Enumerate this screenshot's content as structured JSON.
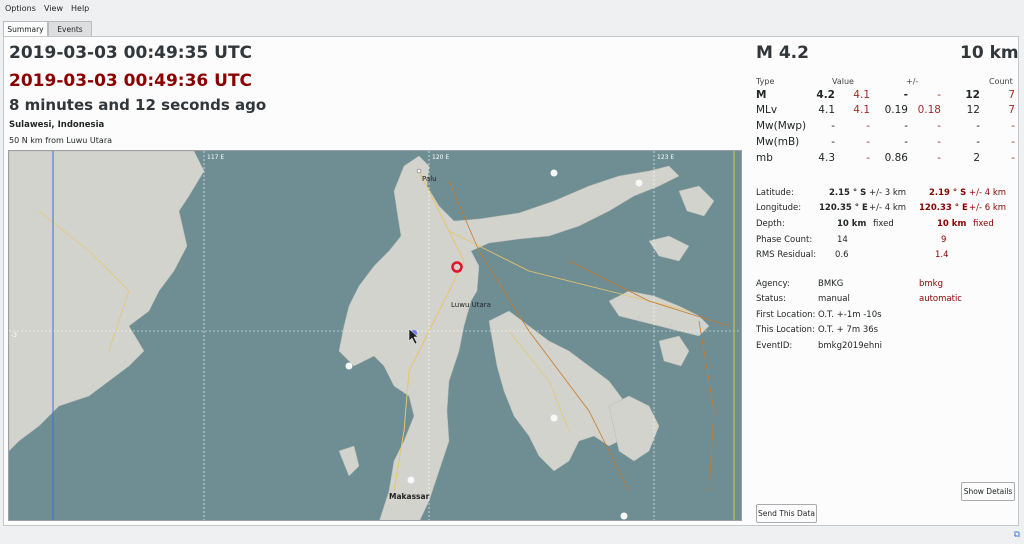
{
  "menu": {
    "items": [
      "Options",
      "View",
      "Help"
    ]
  },
  "tabs": [
    {
      "label": "Summary"
    },
    {
      "label": "Events"
    }
  ],
  "summary": {
    "time1": "2019-03-03 00:49:35 UTC",
    "time2": "2019-03-03 00:49:36 UTC",
    "ago": "8 minutes and 12 seconds ago",
    "region": "Sulawesi, Indonesia",
    "distance": "50 N km from Luwu Utara"
  },
  "map": {
    "grid_labels": [
      "117 E",
      "120 E",
      "123 E",
      "-3"
    ],
    "places": [
      "Palu",
      "Luwu Utara",
      "Makassar"
    ],
    "colors": {
      "water": "#6e8e94",
      "land": "#d2d3cd",
      "event": "#e0142b"
    }
  },
  "event": {
    "magnitude": "M 4.2",
    "depth": "10 km"
  },
  "magnitudes": {
    "headers": {
      "type": "Type",
      "value": "Value",
      "pm": "+/-",
      "count": "Count"
    },
    "rows": [
      {
        "type": "M",
        "v1": "4.2",
        "v2": "4.1",
        "e1": "-",
        "e2": "-",
        "c1": "12",
        "c2": "7",
        "bold": true
      },
      {
        "type": "MLv",
        "v1": "4.1",
        "v2": "4.1",
        "e1": "0.19",
        "e2": "0.18",
        "c1": "12",
        "c2": "7"
      },
      {
        "type": "Mw(Mwp)",
        "v1": "-",
        "v2": "-",
        "e1": "-",
        "e2": "-",
        "c1": "-",
        "c2": "-"
      },
      {
        "type": "Mw(mB)",
        "v1": "-",
        "v2": "-",
        "e1": "-",
        "e2": "-",
        "c1": "-",
        "c2": "-"
      },
      {
        "type": "mb",
        "v1": "4.3",
        "v2": "-",
        "e1": "0.86",
        "e2": "-",
        "c1": "2",
        "c2": "-"
      }
    ]
  },
  "origin": {
    "latitude_label": "Latitude:",
    "latitude": "2.15 ° S",
    "lat_err": "+/-   3 km",
    "latitude2": "2.19 ° S",
    "lat_err2": "+/-   4 km",
    "longitude_label": "Longitude:",
    "longitude": "120.35 ° E",
    "lon_err": "+/-   4 km",
    "longitude2": "120.33 ° E",
    "lon_err2": "+/-   6 km",
    "depth_label": "Depth:",
    "depth": "10 km",
    "depth_type": "fixed",
    "depth2": "10 km",
    "depth_type2": "fixed",
    "phase_label": "Phase Count:",
    "phase": "14",
    "phase2": "9",
    "rms_label": "RMS Residual:",
    "rms": "0.6",
    "rms2": "1.4",
    "agency_label": "Agency:",
    "agency": "BMKG",
    "agency2": "bmkg",
    "status_label": "Status:",
    "status": "manual",
    "status2": "automatic",
    "first_label": "First Location:",
    "first": "O.T. +-1m -10s",
    "this_label": "This Location:",
    "this": "O.T. + 7m 36s",
    "eventid_label": "EventID:",
    "eventid": "bmkg2019ehni"
  },
  "buttons": {
    "show_details": "Show Details",
    "send_data": "Send This Data"
  }
}
